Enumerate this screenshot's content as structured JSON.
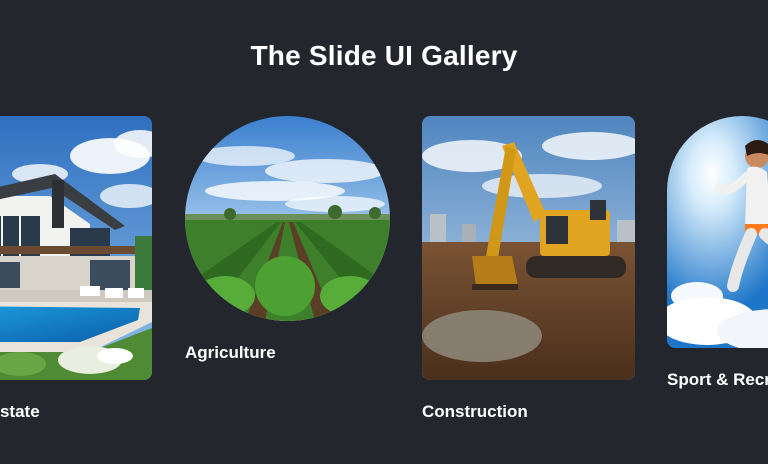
{
  "gallery": {
    "title": "The Slide UI Gallery",
    "cards": [
      {
        "label": "Real Estate",
        "image": "modern-house-with-pool"
      },
      {
        "label": "Agriculture",
        "image": "crop-field-rows"
      },
      {
        "label": "Construction",
        "image": "excavator-on-muddy-site"
      },
      {
        "label": "Sport & Recreation",
        "image": "jumping-athlete-sky"
      }
    ]
  },
  "colors": {
    "background": "#23272d",
    "text": "#ffffff"
  }
}
